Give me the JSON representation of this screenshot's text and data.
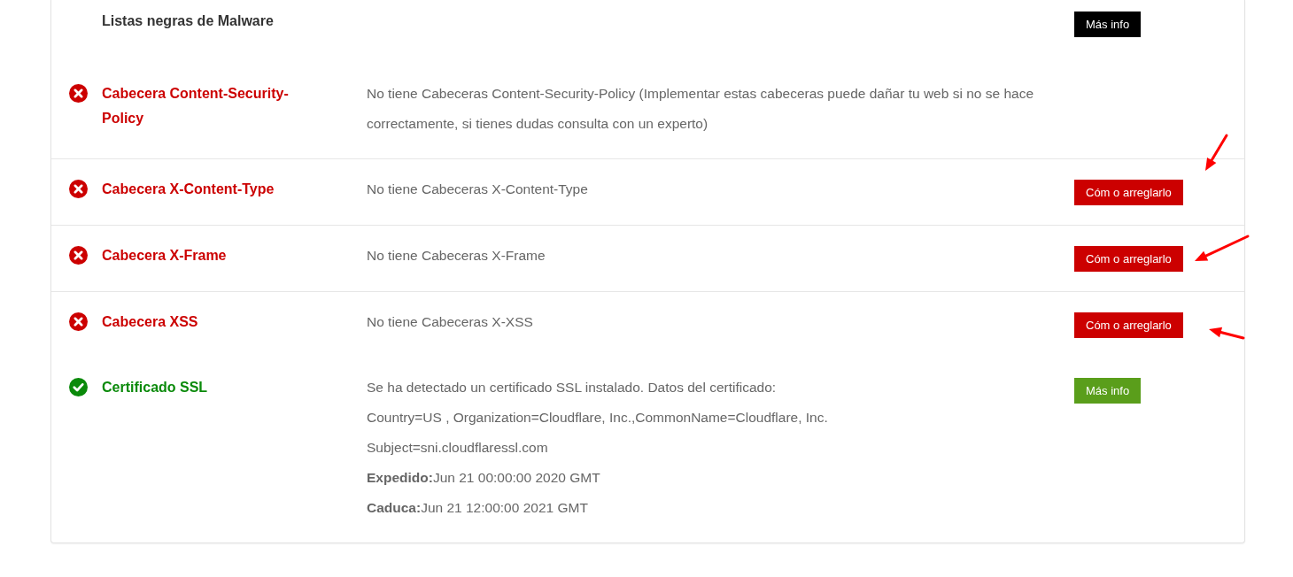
{
  "rows": [
    {
      "kind": "plain",
      "title": "Listas negras de Malware",
      "description": [],
      "button": {
        "label": "Más info",
        "kind": "info-dark"
      },
      "divider": false
    },
    {
      "kind": "fail",
      "title": "Cabecera Content-Security-Policy",
      "description": [
        "No tiene Cabeceras Content-Security-Policy (Implementar estas cabeceras puede dañar tu web si no se hace correctamente, si tienes dudas consulta con un experto)"
      ],
      "divider": true
    },
    {
      "kind": "fail",
      "title": "Cabecera X-Content-Type",
      "description": [
        "No tiene Cabeceras X-Content-Type"
      ],
      "button": {
        "label": "Cóm o arreglarlo",
        "kind": "fix"
      },
      "divider": true,
      "annotation": {
        "kind": "arrow-from-above"
      }
    },
    {
      "kind": "fail",
      "title": "Cabecera X-Frame",
      "description": [
        "No tiene Cabeceras X-Frame"
      ],
      "button": {
        "label": "Cóm o arreglarlo",
        "kind": "fix"
      },
      "divider": true,
      "annotation": {
        "kind": "arrow-from-right"
      }
    },
    {
      "kind": "fail",
      "title": "Cabecera XSS",
      "description": [
        "No tiene Cabeceras X-XSS"
      ],
      "button": {
        "label": "Cóm o arreglarlo",
        "kind": "fix"
      },
      "divider": false,
      "annotation": {
        "kind": "arrow-from-below"
      }
    },
    {
      "kind": "pass",
      "title": "Certificado SSL",
      "description": [
        "Se ha detectado un certificado SSL instalado. Datos del certificado:",
        "Country=US , Organization=Cloudflare, Inc.,CommonName=Cloudflare, Inc.",
        "Subject=sni.cloudflaressl.com",
        "**Expedido:**Jun 21 00:00:00 2020 GMT",
        "**Caduca:**Jun 21 12:00:00 2021 GMT"
      ],
      "button": {
        "label": "Más info",
        "kind": "info-ok"
      },
      "divider": false
    }
  ]
}
